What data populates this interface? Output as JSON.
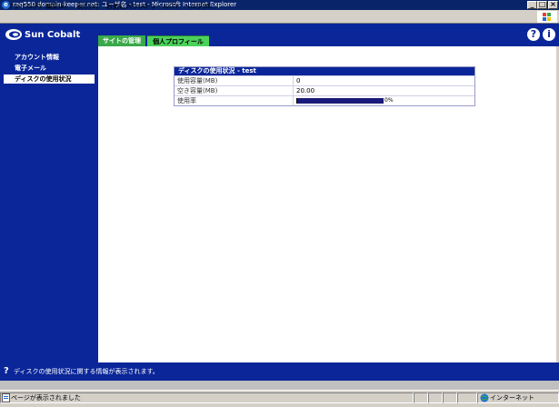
{
  "window": {
    "title": "raq550.domain-keeper.net: ユーザ名 - test - Microsoft Internet Explorer",
    "buttons": {
      "minimize": "_",
      "maximize": "□",
      "close": "×"
    }
  },
  "menubar": {
    "items": [
      "ファイル(F)",
      "編集(E)",
      "表示(V)",
      "お気に入り(A)",
      "ツール(T)",
      "ヘルプ(H)"
    ]
  },
  "header": {
    "logo_text": "Sun Cobalt",
    "tabs": [
      {
        "label": "サイトの管理"
      },
      {
        "label": "個人プロフィール"
      }
    ],
    "help_icon": "?",
    "info_icon": "i"
  },
  "sidebar": {
    "items": [
      {
        "label": "アカウント情報"
      },
      {
        "label": "電子メール"
      },
      {
        "label": "ディスクの使用状況"
      }
    ]
  },
  "disk_table": {
    "title": "ディスクの使用状況 - test",
    "rows": [
      {
        "label": "使用容量(MB)",
        "value": "0"
      },
      {
        "label": "空き容量(MB)",
        "value": "20.00"
      },
      {
        "label": "使用率",
        "percent_text": "0%"
      }
    ],
    "usage_fraction": 0.0
  },
  "infobar": {
    "text": "ディスクの使用状況に関する情報が表示されます。"
  },
  "statusbar": {
    "text": "ページが表示されました",
    "zone": "インターネット"
  },
  "colors": {
    "header_blue": "#0a2699",
    "tab_green": "#3aa94a",
    "tab_active_green": "#4bd25b"
  }
}
